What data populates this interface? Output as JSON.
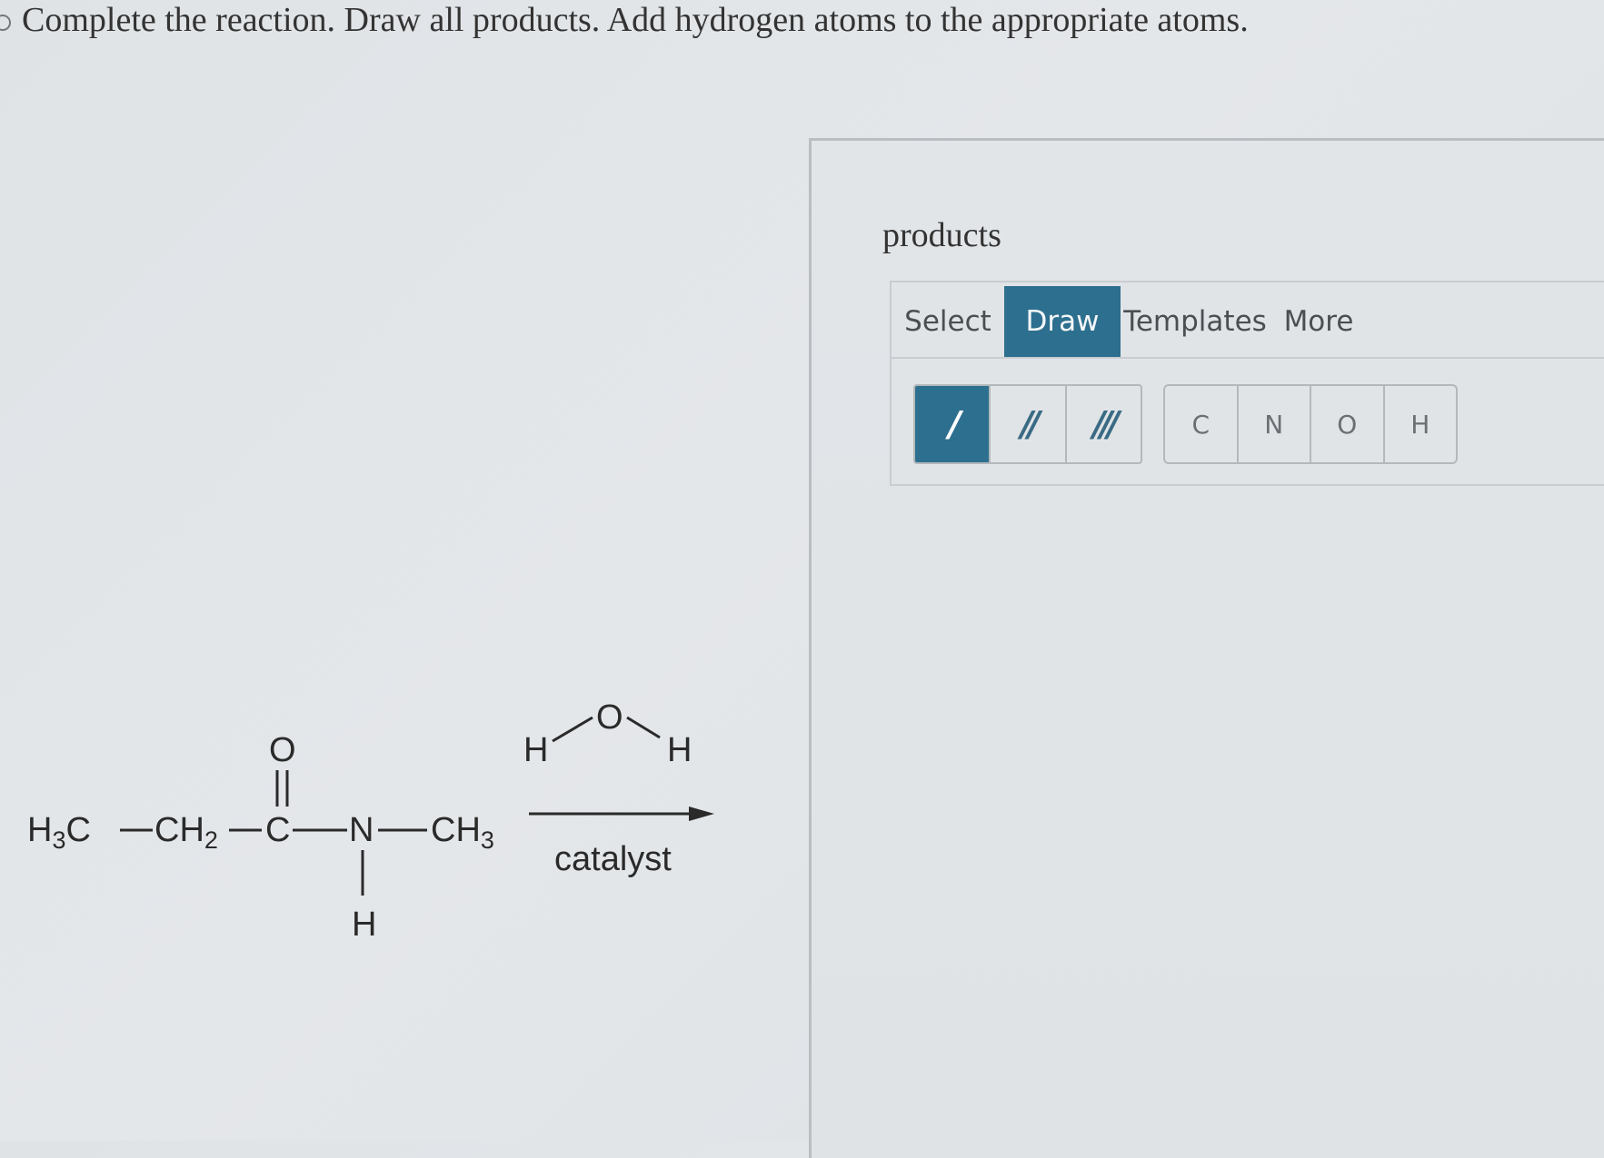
{
  "instruction": "Complete the reaction. Draw all products. Add hydrogen atoms to the appropriate atoms.",
  "reaction": {
    "reactant": {
      "h3c": "H",
      "h3c_sub": "3",
      "h3c_c": "C",
      "ch2": "CH",
      "ch2_sub": "2",
      "carbonyl_c": "C",
      "carbonyl_o": "O",
      "n": "N",
      "ch3": "CH",
      "ch3_sub": "3",
      "nh": "H"
    },
    "reagent": {
      "o": "O",
      "h_left": "H",
      "h_right": "H"
    },
    "condition": "catalyst"
  },
  "panel": {
    "title": "products",
    "tabs": [
      {
        "label": "Select"
      },
      {
        "label": "Draw",
        "active": true
      },
      {
        "label": "Templates"
      },
      {
        "label": "More"
      }
    ],
    "bond_tools": [
      {
        "label": "/",
        "active": true
      },
      {
        "label": "//"
      },
      {
        "label": "///"
      }
    ],
    "atom_tools": [
      {
        "label": "C"
      },
      {
        "label": "N"
      },
      {
        "label": "O"
      },
      {
        "label": "H"
      }
    ]
  },
  "colors": {
    "accent": "#2d6f8e",
    "background": "#e1e4e7"
  }
}
